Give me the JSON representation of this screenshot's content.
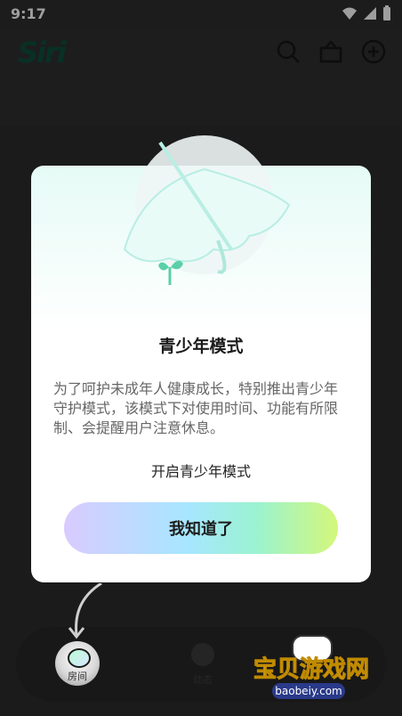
{
  "status_bar": {
    "time": "9:17"
  },
  "app": {
    "logo_text": "Siri"
  },
  "dialog": {
    "title": "青少年模式",
    "description": "为了呵护未成年人健康成长，特别推出青少年守护模式，该模式下对使用时间、功能有所限制、会提醒用户注意休息。",
    "open_link": "开启青少年模式",
    "ack_button": "我知道了"
  },
  "bottom_nav": {
    "room_label": "房间",
    "dynamic_label": "动态"
  },
  "watermark": {
    "text": "宝贝游戏网",
    "domain": "baobeiy.com"
  },
  "colors": {
    "accent_gradient_start": "#d9cbff",
    "accent_gradient_end": "#d4f77a",
    "logo": "#0f4b3a"
  }
}
